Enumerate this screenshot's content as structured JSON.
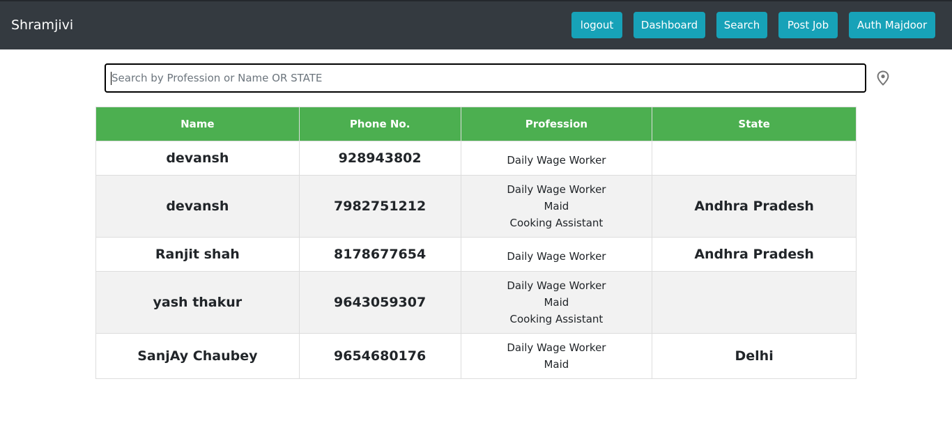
{
  "navbar": {
    "brand": "Shramjivi",
    "buttons": {
      "logout": "logout",
      "dashboard": "Dashboard",
      "search": "Search",
      "post_job": "Post Job",
      "auth_majdoor": "Auth Majdoor"
    }
  },
  "search": {
    "placeholder": "Search by Profession or Name OR STATE",
    "value": ""
  },
  "table": {
    "headers": {
      "name": "Name",
      "phone": "Phone No.",
      "profession": "Profession",
      "state": "State"
    },
    "rows": [
      {
        "name": "devansh",
        "phone": "928943802",
        "professions": [
          "Daily Wage Worker"
        ],
        "state": ""
      },
      {
        "name": "devansh",
        "phone": "7982751212",
        "professions": [
          "Daily Wage Worker",
          "Maid",
          "Cooking Assistant"
        ],
        "state": "Andhra Pradesh"
      },
      {
        "name": "Ranjit shah",
        "phone": "8178677654",
        "professions": [
          "Daily Wage Worker"
        ],
        "state": "Andhra Pradesh"
      },
      {
        "name": "yash thakur",
        "phone": "9643059307",
        "professions": [
          "Daily Wage Worker",
          "Maid",
          "Cooking Assistant"
        ],
        "state": ""
      },
      {
        "name": "SanjAy Chaubey",
        "phone": "9654680176",
        "professions": [
          "Daily Wage Worker",
          "Maid"
        ],
        "state": "Delhi"
      }
    ]
  },
  "colors": {
    "navbar_bg": "#343a40",
    "button_bg": "#17a2b8",
    "table_header_bg": "#4caf50",
    "row_alt_bg": "#f2f2f2"
  },
  "icons": {
    "location": "map-pin-icon"
  }
}
